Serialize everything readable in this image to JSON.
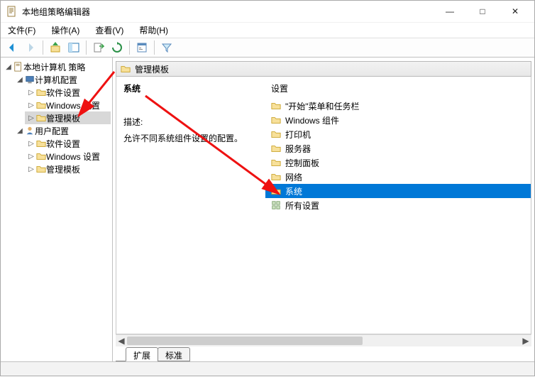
{
  "window": {
    "title": "本地组策略编辑器"
  },
  "menu": {
    "file": "文件(F)",
    "action": "操作(A)",
    "view": "查看(V)",
    "help": "帮助(H)"
  },
  "tree": {
    "root": "本地计算机 策略",
    "computer_config": "计算机配置",
    "computer_children": {
      "software": "软件设置",
      "windows": "Windows 设置",
      "admin_templates": "管理模板"
    },
    "user_config": "用户配置",
    "user_children": {
      "software": "软件设置",
      "windows": "Windows 设置",
      "admin_templates": "管理模板"
    }
  },
  "content": {
    "header": "管理模板",
    "heading": "系统",
    "desc_label": "描述:",
    "desc_text": "允许不同系统组件设置的配置。",
    "settings_label": "设置",
    "items": {
      "start_menu": "\"开始\"菜单和任务栏",
      "win_components": "Windows 组件",
      "printers": "打印机",
      "servers": "服务器",
      "control_panel": "控制面板",
      "network": "网络",
      "system": "系统",
      "all_settings": "所有设置"
    }
  },
  "tabs": {
    "extended": "扩展",
    "standard": "标准"
  }
}
